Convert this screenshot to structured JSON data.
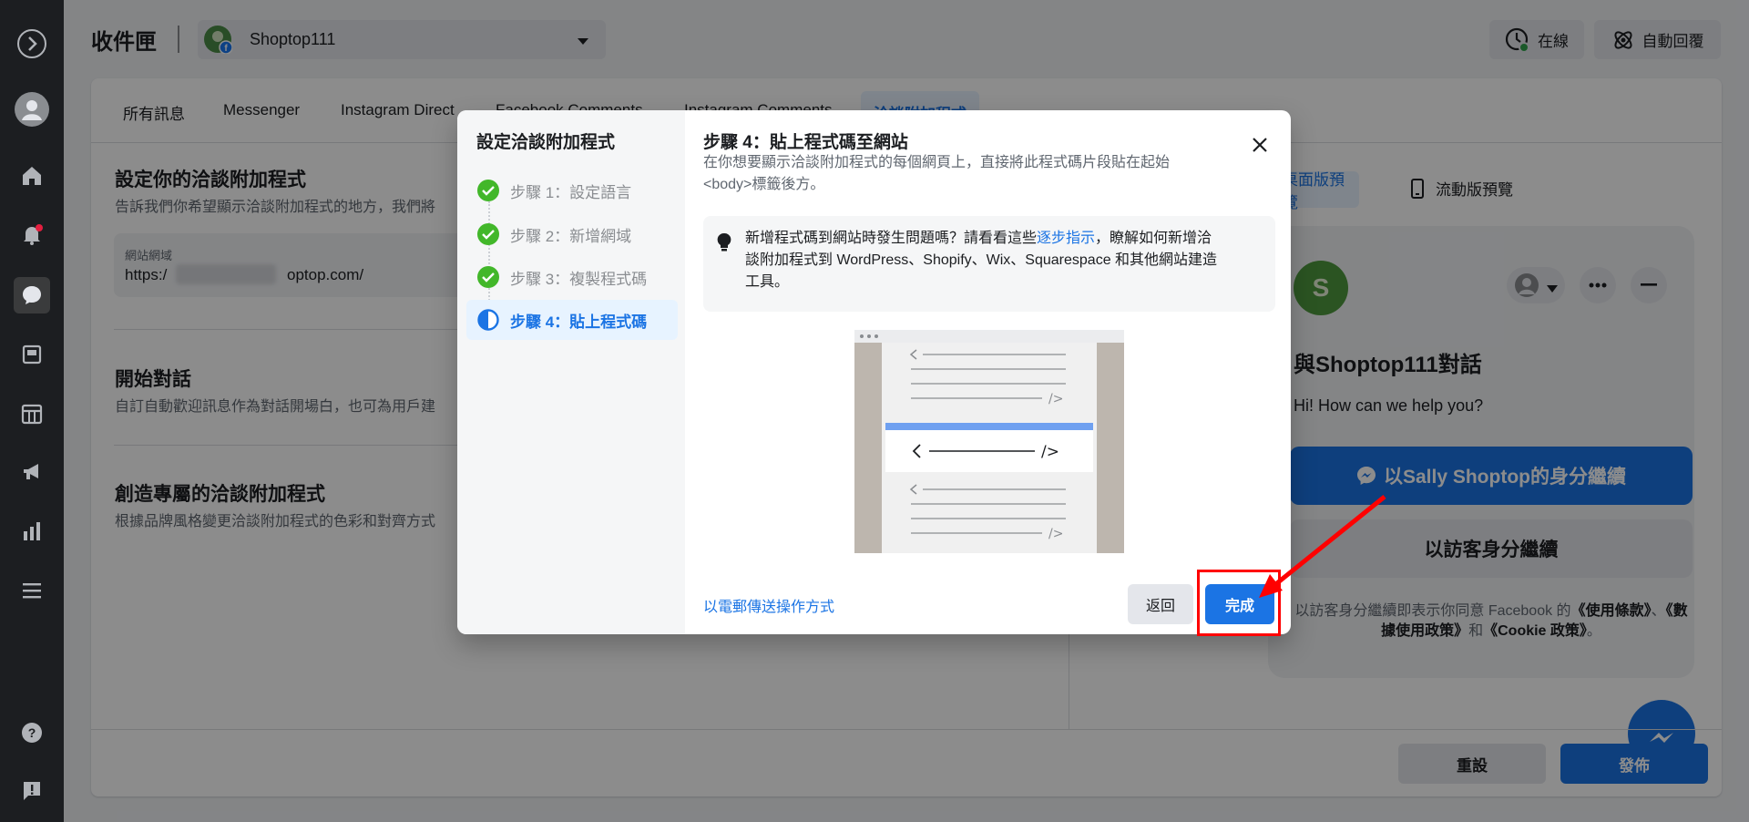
{
  "header": {
    "title": "收件匣",
    "page_name": "Shoptop111",
    "online_label": "在線",
    "auto_reply_label": "自動回覆"
  },
  "tabs": [
    "所有訊息",
    "Messenger",
    "Instagram Direct",
    "Facebook Comments",
    "Instagram Comments",
    "洽談附加程式"
  ],
  "left_panel": {
    "setup": {
      "title": "設定你的洽談附加程式",
      "subtitle": "告訴我們你希望顯示洽談附加程式的地方，我們將",
      "field_label": "網站網域",
      "field_value_start": "https:/",
      "field_value_end": "optop.com/"
    },
    "start": {
      "title": "開始對話",
      "subtitle": "自訂自動歡迎訊息作為對話開場白，也可為用戶建"
    },
    "custom": {
      "title": "創造專屬的洽談附加程式",
      "subtitle": "根據品牌風格變更洽談附加程式的色彩和對齊方式"
    }
  },
  "preview": {
    "desktop_label": "桌面版預覽",
    "mobile_label": "流動版預覽",
    "avatar_letter": "S",
    "chat_title": "與Shoptop111對話",
    "greeting": "Hi! How can we help you?",
    "continue_as": "以Sally Shoptop的身分繼續",
    "continue_guest": "以訪客身分繼續",
    "terms_part1": "以訪客身分繼續即表示你同意 Facebook 的",
    "terms_link1": "《使用條款》",
    "terms_sep": "、",
    "terms_link2": "《數據使用政策》",
    "terms_and": "和",
    "terms_link3": "《Cookie 政策》",
    "terms_end": "。"
  },
  "footer": {
    "reset_label": "重設",
    "publish_label": "發佈"
  },
  "modal": {
    "sidebar_title": "設定洽談附加程式",
    "steps": [
      {
        "label": "步驟 1：設定語言",
        "state": "done"
      },
      {
        "label": "步驟 2：新增網域",
        "state": "done"
      },
      {
        "label": "步驟 3：複製程式碼",
        "state": "done"
      },
      {
        "label": "步驟 4：貼上程式碼",
        "state": "active"
      }
    ],
    "heading": "步驟 4：貼上程式碼至網站",
    "description_line1": "在你想要顯示洽談附加程式的每個網頁上，直接將此程式碼片段貼在起始",
    "description_line2": "<body>標籤後方。",
    "tip_text1": "新增程式碼到網站時發生問題嗎？請看看這些",
    "tip_link": "逐步指示",
    "tip_text2": "，瞭解如何新增洽",
    "tip_line2": "談附加程式到 WordPress、Shopify、Wix、Squarespace 和其他網站建造",
    "tip_line3": "工具。",
    "email_link": "以電郵傳送操作方式",
    "back_label": "返回",
    "done_label": "完成"
  },
  "colors": {
    "accent": "#1b74e4",
    "dark_nav": "#1c1e21",
    "annotation": "#ff0000",
    "success": "#42b72a"
  }
}
